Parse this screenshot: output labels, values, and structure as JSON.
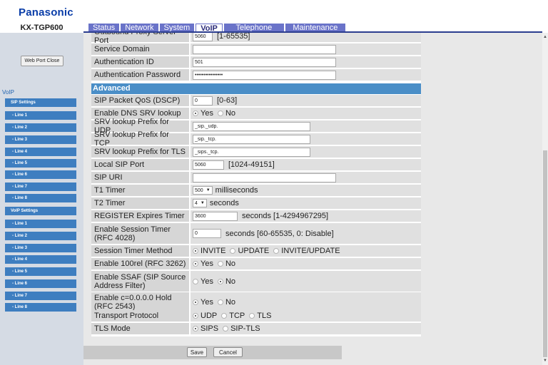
{
  "brand": "Panasonic",
  "model": "KX-TGP600",
  "tabs": [
    "Status",
    "Network",
    "System",
    "VoIP",
    "Telephone",
    "Maintenance"
  ],
  "sidebar": {
    "web_port_close": "Web Port Close",
    "voip_title": "VoIP",
    "sip_settings": "SIP Settings",
    "sip_lines": [
      "- Line 1",
      "- Line 2",
      "- Line 3",
      "- Line 4",
      "- Line 5",
      "- Line 6",
      "- Line 7",
      "- Line 8"
    ],
    "voip_settings": "VoIP Settings",
    "voip_lines": [
      "- Line 1",
      "- Line 2",
      "- Line 3",
      "- Line 4",
      "- Line 5",
      "- Line 6",
      "- Line 7",
      "- Line 8"
    ]
  },
  "top_rows": {
    "outbound_proxy_port": {
      "label": "Outbound Proxy Server Port",
      "value": "5060",
      "hint": "[1-65535]"
    },
    "service_domain": {
      "label": "Service Domain",
      "value": ""
    },
    "auth_id": {
      "label": "Authentication ID",
      "value": "501"
    },
    "auth_password": {
      "label": "Authentication Password",
      "value": "••••••••••••••••"
    }
  },
  "advanced": {
    "title": "Advanced",
    "sip_qos": {
      "label": "SIP Packet QoS (DSCP)",
      "value": "0",
      "hint": "[0-63]"
    },
    "dns_srv": {
      "label": "Enable DNS SRV lookup",
      "options": [
        "Yes",
        "No"
      ],
      "selected": "Yes"
    },
    "srv_udp": {
      "label": "SRV lookup Prefix for UDP",
      "value": "_sip._udp."
    },
    "srv_tcp": {
      "label": "SRV lookup Prefix for TCP",
      "value": "_sip._tcp."
    },
    "srv_tls": {
      "label": "SRV lookup Prefix for TLS",
      "value": "_sips._tcp."
    },
    "local_sip_port": {
      "label": "Local SIP Port",
      "value": "5060",
      "hint": "[1024-49151]"
    },
    "sip_uri": {
      "label": "SIP URI",
      "value": ""
    },
    "t1_timer": {
      "label": "T1 Timer",
      "value": "500",
      "unit": "milliseconds"
    },
    "t2_timer": {
      "label": "T2 Timer",
      "value": "4",
      "unit": "seconds"
    },
    "register_expires": {
      "label": "REGISTER Expires Timer",
      "value": "3600",
      "hint": "seconds [1-4294967295]"
    },
    "session_timer": {
      "label": "Enable Session Timer (RFC 4028)",
      "value": "0",
      "hint": "seconds [60-65535, 0: Disable]"
    },
    "session_method": {
      "label": "Session Timer Method",
      "options": [
        "INVITE",
        "UPDATE",
        "INVITE/UPDATE"
      ],
      "selected": "INVITE"
    },
    "rel100": {
      "label": "Enable 100rel (RFC 3262)",
      "options": [
        "Yes",
        "No"
      ],
      "selected": "Yes"
    },
    "ssaf": {
      "label": "Enable SSAF (SIP Source Address Filter)",
      "options": [
        "Yes",
        "No"
      ],
      "selected": "No"
    },
    "hold": {
      "label": "Enable c=0.0.0.0 Hold (RFC 2543)",
      "options": [
        "Yes",
        "No"
      ],
      "selected": "Yes"
    },
    "transport": {
      "label": "Transport Protocol",
      "options": [
        "UDP",
        "TCP",
        "TLS"
      ],
      "selected": "UDP"
    },
    "tls_mode": {
      "label": "TLS Mode",
      "options": [
        "SIPS",
        "SIP-TLS"
      ],
      "selected": "SIPS"
    }
  },
  "buttons": {
    "save": "Save",
    "cancel": "Cancel"
  },
  "scroll": {
    "up": "▲",
    "down": "▼"
  },
  "colors": {
    "brand": "#0a3da8",
    "tab": "#6a73c9",
    "section": "#4a8ec7",
    "nav": "#3e7ec0"
  }
}
